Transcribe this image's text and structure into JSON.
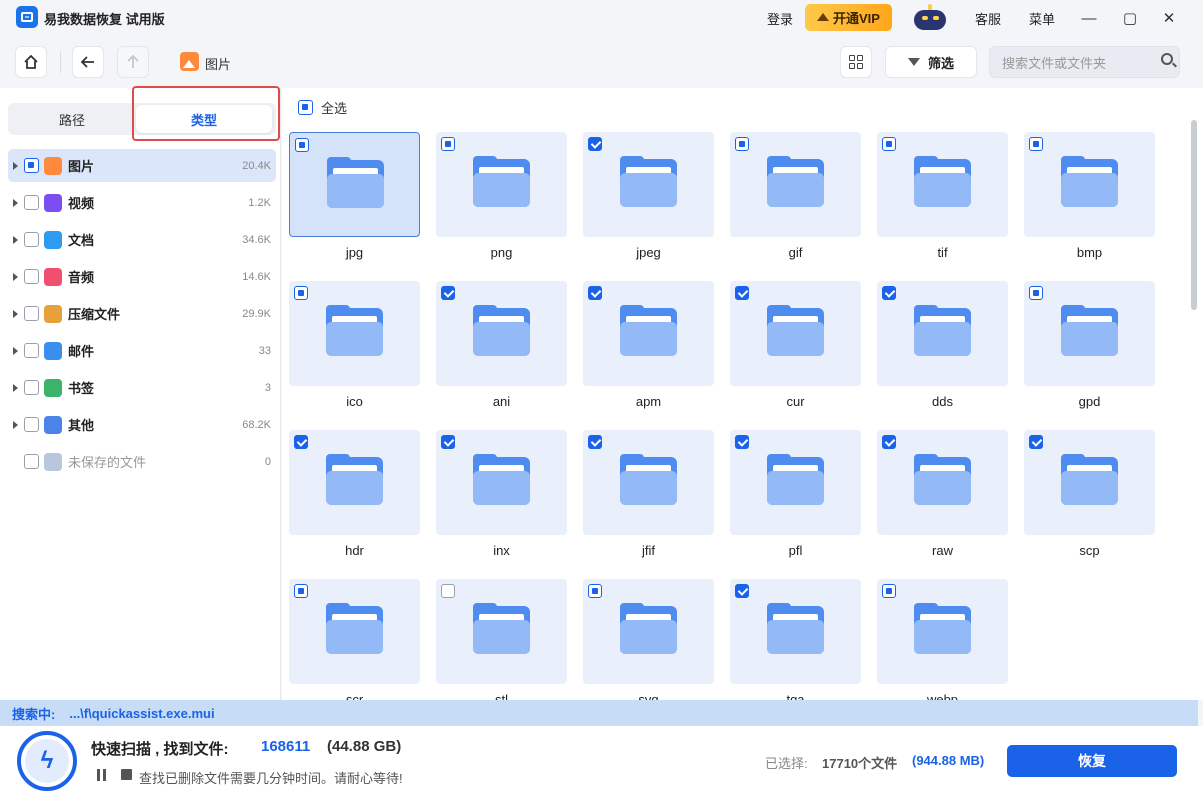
{
  "app": {
    "title": "易我数据恢复 试用版"
  },
  "titlebar": {
    "login": "登录",
    "vip": "开通VIP",
    "service": "客服",
    "menu": "菜单"
  },
  "toolbar": {
    "breadcrumb": "图片",
    "filter_label": "筛选",
    "search_placeholder": "搜索文件或文件夹"
  },
  "sidebar": {
    "tabs": [
      {
        "label": "路径",
        "active": false
      },
      {
        "label": "类型",
        "active": true
      }
    ],
    "items": [
      {
        "label": "图片",
        "count": "20.4K",
        "check": "partial",
        "selected": true,
        "color": "#ff8a3d",
        "icon": "image-icon"
      },
      {
        "label": "视频",
        "count": "1.2K",
        "check": "none",
        "selected": false,
        "color": "#7a4ef0",
        "icon": "video-icon"
      },
      {
        "label": "文档",
        "count": "34.6K",
        "check": "none",
        "selected": false,
        "color": "#2f9bf0",
        "icon": "document-icon"
      },
      {
        "label": "音频",
        "count": "14.6K",
        "check": "none",
        "selected": false,
        "color": "#f0506e",
        "icon": "audio-icon"
      },
      {
        "label": "压缩文件",
        "count": "29.9K",
        "check": "none",
        "selected": false,
        "color": "#e8a13a",
        "icon": "archive-icon"
      },
      {
        "label": "邮件",
        "count": "33",
        "check": "none",
        "selected": false,
        "color": "#3a8ef0",
        "icon": "mail-icon"
      },
      {
        "label": "书签",
        "count": "3",
        "check": "none",
        "selected": false,
        "color": "#3cb36a",
        "icon": "bookmark-icon"
      },
      {
        "label": "其他",
        "count": "68.2K",
        "check": "none",
        "selected": false,
        "color": "#4a84e8",
        "icon": "other-folder-icon"
      },
      {
        "label": "未保存的文件",
        "count": "0",
        "check": "none",
        "selected": false,
        "color": "#b9c7dd",
        "icon": "unsaved-file-icon",
        "muted": true,
        "no_caret": true
      }
    ]
  },
  "content": {
    "select_all": "全选",
    "tiles": [
      {
        "label": "jpg",
        "check": "partial",
        "selected": true
      },
      {
        "label": "png",
        "check": "partial"
      },
      {
        "label": "jpeg",
        "check": "checked"
      },
      {
        "label": "gif",
        "check": "partial"
      },
      {
        "label": "tif",
        "check": "partial"
      },
      {
        "label": "bmp",
        "check": "partial"
      },
      {
        "label": "ico",
        "check": "partial"
      },
      {
        "label": "ani",
        "check": "checked"
      },
      {
        "label": "apm",
        "check": "checked"
      },
      {
        "label": "cur",
        "check": "checked"
      },
      {
        "label": "dds",
        "check": "checked"
      },
      {
        "label": "gpd",
        "check": "partial"
      },
      {
        "label": "hdr",
        "check": "checked"
      },
      {
        "label": "inx",
        "check": "checked"
      },
      {
        "label": "jfif",
        "check": "checked"
      },
      {
        "label": "pfl",
        "check": "checked"
      },
      {
        "label": "raw",
        "check": "checked"
      },
      {
        "label": "scp",
        "check": "checked"
      },
      {
        "label": "scr",
        "check": "partial"
      },
      {
        "label": "stl",
        "check": "none"
      },
      {
        "label": "svg",
        "check": "partial"
      },
      {
        "label": "tga",
        "check": "checked"
      },
      {
        "label": "webp",
        "check": "partial"
      }
    ]
  },
  "status": {
    "searching_label": "搜索中:",
    "searching_path": "...\\f\\quickassist.exe.mui",
    "scan_title": "快速扫描 , 找到文件:",
    "found_count": "168611",
    "found_size": "(44.88 GB)",
    "note": "查找已删除文件需要几分钟时间。请耐心等待!",
    "selected_label": "已选择:",
    "selected_count": "17710个文件",
    "selected_size": "(944.88 MB)",
    "recover_label": "恢复"
  }
}
